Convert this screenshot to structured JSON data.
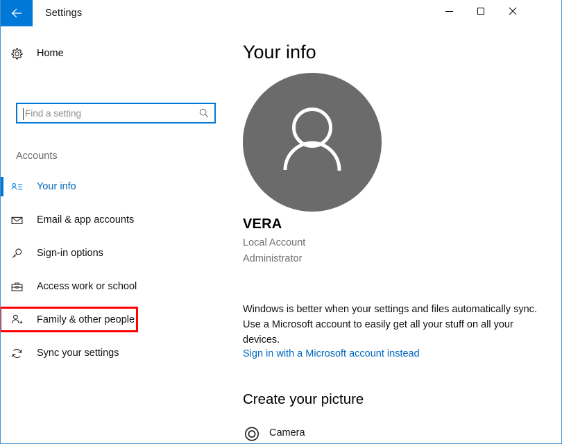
{
  "window": {
    "title": "Settings",
    "back_icon": "back-arrow-icon",
    "minimize_label": "",
    "maximize_label": "",
    "close_label": "✕"
  },
  "sidebar": {
    "home": {
      "label": "Home",
      "icon": "gear-icon"
    },
    "search": {
      "value": "",
      "placeholder": "Find a setting",
      "icon": "search-icon"
    },
    "section_label": "Accounts",
    "items": [
      {
        "label": "Your info",
        "icon": "contact-card-icon",
        "selected": true,
        "highlighted": false
      },
      {
        "label": "Email & app accounts",
        "icon": "envelope-icon",
        "selected": false,
        "highlighted": false
      },
      {
        "label": "Sign-in options",
        "icon": "key-icon",
        "selected": false,
        "highlighted": false
      },
      {
        "label": "Access work or school",
        "icon": "briefcase-icon",
        "selected": false,
        "highlighted": false
      },
      {
        "label": "Family & other people",
        "icon": "person-add-icon",
        "selected": false,
        "highlighted": true
      },
      {
        "label": "Sync your settings",
        "icon": "sync-icon",
        "selected": false,
        "highlighted": false
      }
    ]
  },
  "main": {
    "page_title": "Your info",
    "avatar_icon": "person-avatar-icon",
    "account_name": "VERA",
    "account_type": "Local Account",
    "account_role": "Administrator",
    "sync_description": "Windows is better when your settings and files automatically sync. Use a Microsoft account to easily get all your stuff on all your devices.",
    "microsoft_link": "Sign in with a Microsoft account instead",
    "create_picture_title": "Create your picture",
    "camera": {
      "label": "Camera",
      "icon": "camera-icon"
    }
  },
  "colors": {
    "accent": "#0078d7",
    "link": "#0067c0",
    "highlight": "#ff0000",
    "avatar_bg": "#6b6b6b",
    "window_border": "#4a90c9"
  }
}
